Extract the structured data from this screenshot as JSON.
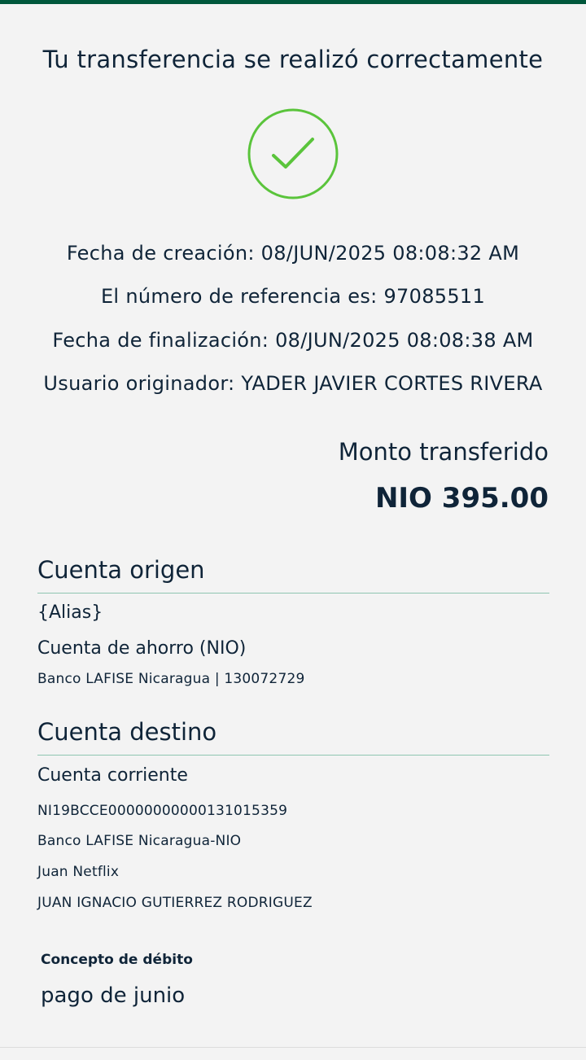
{
  "header": {
    "title": "Tu transferencia se realizó correctamente"
  },
  "status": {
    "icon": "check-circle-icon",
    "color": "#5ac43b"
  },
  "details": {
    "creation_date": "Fecha de creación: 08/JUN/2025 08:08:32 AM",
    "reference": "El número de referencia es: 97085511",
    "completion_date": "Fecha de finalización: 08/JUN/2025 08:08:38 AM",
    "originator": "Usuario originador: YADER JAVIER CORTES RIVERA"
  },
  "amount": {
    "label": "Monto transferido",
    "value": "NIO 395.00"
  },
  "origin": {
    "title": "Cuenta origen",
    "alias": "{Alias}",
    "account_type": "Cuenta de ahorro (NIO)",
    "bank_account": "Banco LAFISE Nicaragua | 130072729"
  },
  "destination": {
    "title": "Cuenta destino",
    "account_type": "Cuenta corriente",
    "iban": "NI19BCCE00000000000131015359",
    "bank": "Banco LAFISE Nicaragua-NIO",
    "nickname": "Juan Netflix",
    "holder": "JUAN IGNACIO GUTIERREZ RODRIGUEZ"
  },
  "concept": {
    "label": "Concepto de débito",
    "value": "pago de junio"
  },
  "colors": {
    "brand": "#00573b",
    "text": "#0f2438",
    "divider": "#8fc5b1",
    "background": "#f3f3f3"
  }
}
